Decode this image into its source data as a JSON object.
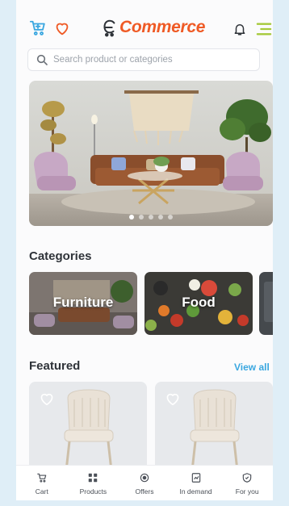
{
  "header": {
    "logo_text": "Commerce",
    "brand_color": "#ef5a25",
    "cart_icon_color": "#3aa7e0",
    "heart_icon_color": "#ef5a25",
    "menu_icon_color": "#a6c93a"
  },
  "search": {
    "placeholder": "Search product or categories"
  },
  "banner": {
    "slides": 5,
    "active_slide": 1
  },
  "sections": {
    "categories_title": "Categories",
    "featured_title": "Featured",
    "view_all_label": "View all"
  },
  "categories": [
    {
      "label": "Furniture"
    },
    {
      "label": "Food"
    }
  ],
  "bottom_nav": [
    {
      "label": "Cart",
      "icon": "cart-icon"
    },
    {
      "label": "Products",
      "icon": "grid-icon"
    },
    {
      "label": "Offers",
      "icon": "offers-icon"
    },
    {
      "label": "In demand",
      "icon": "trending-icon"
    },
    {
      "label": "For you",
      "icon": "shield-icon"
    }
  ]
}
